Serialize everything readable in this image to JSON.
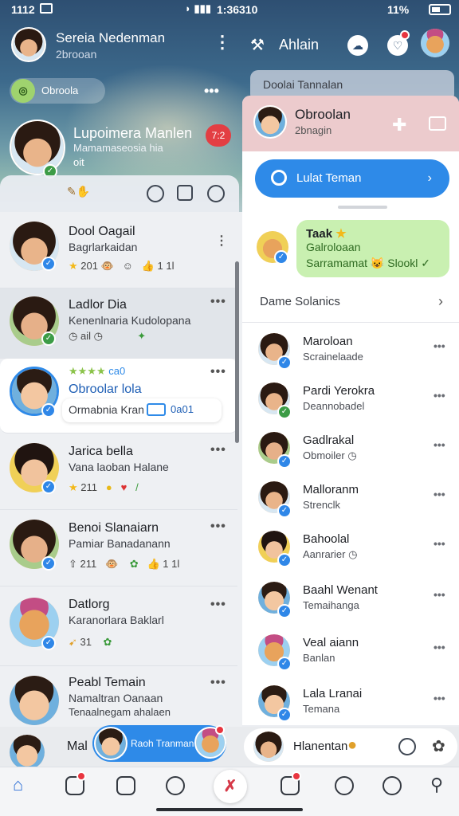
{
  "status": {
    "time": "1112",
    "center_time": "1:36310",
    "battery": "11%"
  },
  "left_header": {
    "title": "Sereia Nedenman",
    "subtitle": "2brooan"
  },
  "right_header": {
    "label": "Ahlain"
  },
  "top_pill": {
    "label": "Obroola"
  },
  "featured": {
    "name": "Lupoimera Manlen",
    "sub": "Mamamaseosia hia",
    "sub2": "oit",
    "badge": "7:2"
  },
  "ghost_card": {
    "label": "Doolai Tannalan"
  },
  "left_chats": [
    {
      "name": "Dool Oagail",
      "sub": "Bagrlarkaidan",
      "meta": "201",
      "meta2": "1 1l"
    },
    {
      "name": "Ladlor Dia",
      "sub": "Kenenlnaria Kudolopana",
      "meta": "ail"
    },
    {
      "name": "Obroolar lola",
      "sub": "Ormabnia Kran",
      "tag": "ca0",
      "pill": "0a01"
    },
    {
      "name": "Jarica bella",
      "sub": "Vana laoban Halane",
      "meta": "211"
    },
    {
      "name": "Benoi Slanaiarn",
      "sub": "Pamiar Banadanann",
      "meta": "211",
      "meta2": "1 1l"
    },
    {
      "name": "Datlorg",
      "sub": "Karanorlara Baklarl",
      "meta": "31"
    },
    {
      "name": "Peabl Temain",
      "sub": "Namaltran Oanaan",
      "sub2": "Tenaalnegam ahalaen"
    },
    {
      "name": "Mal"
    }
  ],
  "right_panel": {
    "header_name": "Obroolan",
    "header_sub": "2bnagin",
    "search_label": "Lulat Teman",
    "green_card": {
      "title": "Taak",
      "line2": "Galroloaan",
      "line3": "Sarramamat",
      "line3_tail": "Slookl"
    },
    "section_title": "Dame Solanics",
    "contacts": [
      {
        "name": "Maroloan",
        "sub": "Scrainelaade"
      },
      {
        "name": "Pardi Yerokra",
        "sub": "Deannobadel"
      },
      {
        "name": "Gadlrakal",
        "sub": "Obmoiler"
      },
      {
        "name": "Malloranm",
        "sub": "Strenclk"
      },
      {
        "name": "Bahoolal",
        "sub": "Aanrarier"
      },
      {
        "name": "Baahl Wenant",
        "sub": "Temaihanga"
      },
      {
        "name": "Veal aiann",
        "sub": "Banlan"
      },
      {
        "name": "Lala Lranai",
        "sub": "Temana"
      }
    ]
  },
  "bottom": {
    "mini_pill": "Raoh Tranman",
    "right_mini": "Hlanentan"
  },
  "colors": {
    "accent": "#2e8ae8",
    "alert": "#e33e43",
    "green_card": "#c9f0b1",
    "header_pink": "#eccbcd"
  },
  "icons": [
    "home-icon",
    "note-icon",
    "square-icon",
    "heart-icon",
    "center-action-icon",
    "chat-icon",
    "emoji-icon",
    "reaction-icon",
    "profile-icon"
  ]
}
